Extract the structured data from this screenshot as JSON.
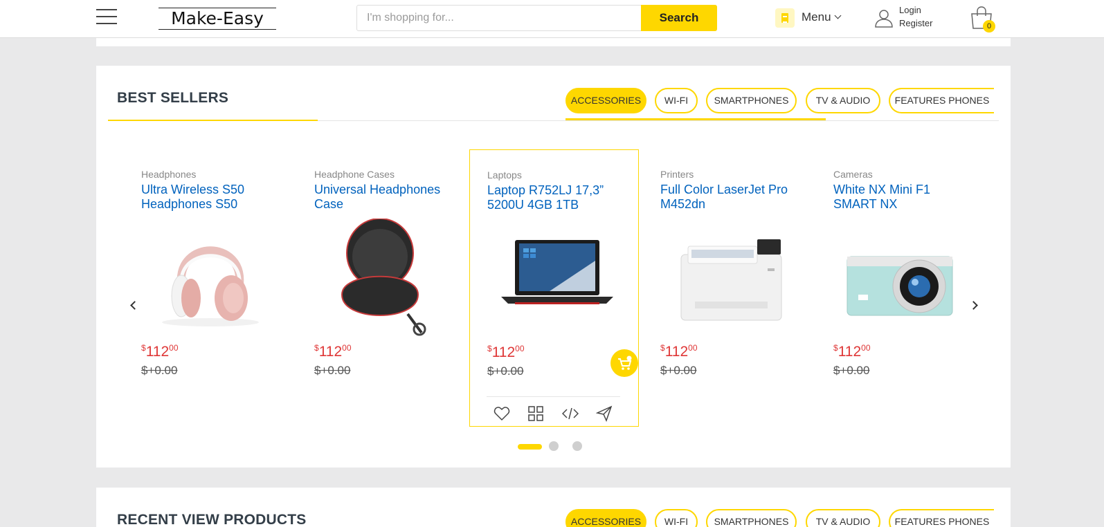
{
  "header": {
    "logo": "Make-Easy",
    "search_placeholder": "I'm shopping for...",
    "search_button": "Search",
    "menu_label": "Menu",
    "login": "Login",
    "register": "Register",
    "cart_count": "0"
  },
  "best_sellers": {
    "title": "BEST SELLERS",
    "tabs": [
      "ACCESSORIES",
      "WI-FI",
      "SMARTPHONES",
      "TV & AUDIO",
      "FEATURES PHONES"
    ],
    "active_tab": "ACCESSORIES",
    "products": [
      {
        "category": "Headphones",
        "name": "Ultra Wireless S50 Headphones S50",
        "price_symbol": "$",
        "price_main": "112",
        "price_cents": "00",
        "old_price": "$+0.00",
        "image": "headphones-image"
      },
      {
        "category": "Headphone Cases",
        "name": "Universal Headphones Case",
        "price_symbol": "$",
        "price_main": "112",
        "price_cents": "00",
        "old_price": "$+0.00",
        "image": "headphone-case-image"
      },
      {
        "category": "Laptops",
        "name": "Laptop R752LJ 17,3” 5200U 4GB 1TB",
        "price_symbol": "$",
        "price_main": "112",
        "price_cents": "00",
        "old_price": "$+0.00",
        "image": "laptop-image"
      },
      {
        "category": "Printers",
        "name": "Full Color LaserJet Pro M452dn",
        "price_symbol": "$",
        "price_main": "112",
        "price_cents": "00",
        "old_price": "$+0.00",
        "image": "printer-image"
      },
      {
        "category": "Cameras",
        "name": "White NX Mini F1 SMART NX",
        "price_symbol": "$",
        "price_main": "112",
        "price_cents": "00",
        "old_price": "$+0.00",
        "image": "camera-image"
      }
    ],
    "pagination_dots": 3,
    "active_dot": 1
  },
  "recent": {
    "title": "RECENT VIEW PRODUCTS",
    "tabs": [
      "ACCESSORIES",
      "WI-FI",
      "SMARTPHONES",
      "TV & AUDIO",
      "FEATURES PHONES"
    ],
    "active_tab": "ACCESSORIES"
  },
  "colors": {
    "accent": "#fed700",
    "link": "#0062bd",
    "price": "#df3737"
  }
}
